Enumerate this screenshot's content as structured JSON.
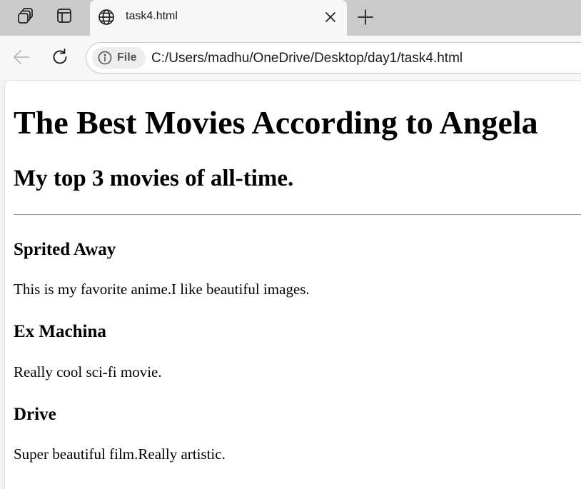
{
  "browser": {
    "tab": {
      "title": "task4.html"
    },
    "address_bar": {
      "site_info_label": "File",
      "url": "C:/Users/madhu/OneDrive/Desktop/day1/task4.html"
    },
    "icons": {
      "workspaces": "workspaces-icon",
      "tab_actions": "tab-actions-icon",
      "favicon": "globe-icon",
      "close_tab": "close-icon",
      "new_tab": "plus-icon",
      "back": "back-arrow-icon",
      "reload": "reload-icon",
      "site_info": "info-icon"
    }
  },
  "page": {
    "heading": "The Best Movies According to Angela",
    "subheading": "My top 3 movies of all-time.",
    "movies": [
      {
        "title": "Sprited Away",
        "description": "This is my favorite anime.I like beautiful images."
      },
      {
        "title": "Ex Machina",
        "description": "Really cool sci-fi movie."
      },
      {
        "title": "Drive",
        "description": "Super beautiful film.Really artistic."
      }
    ]
  }
}
